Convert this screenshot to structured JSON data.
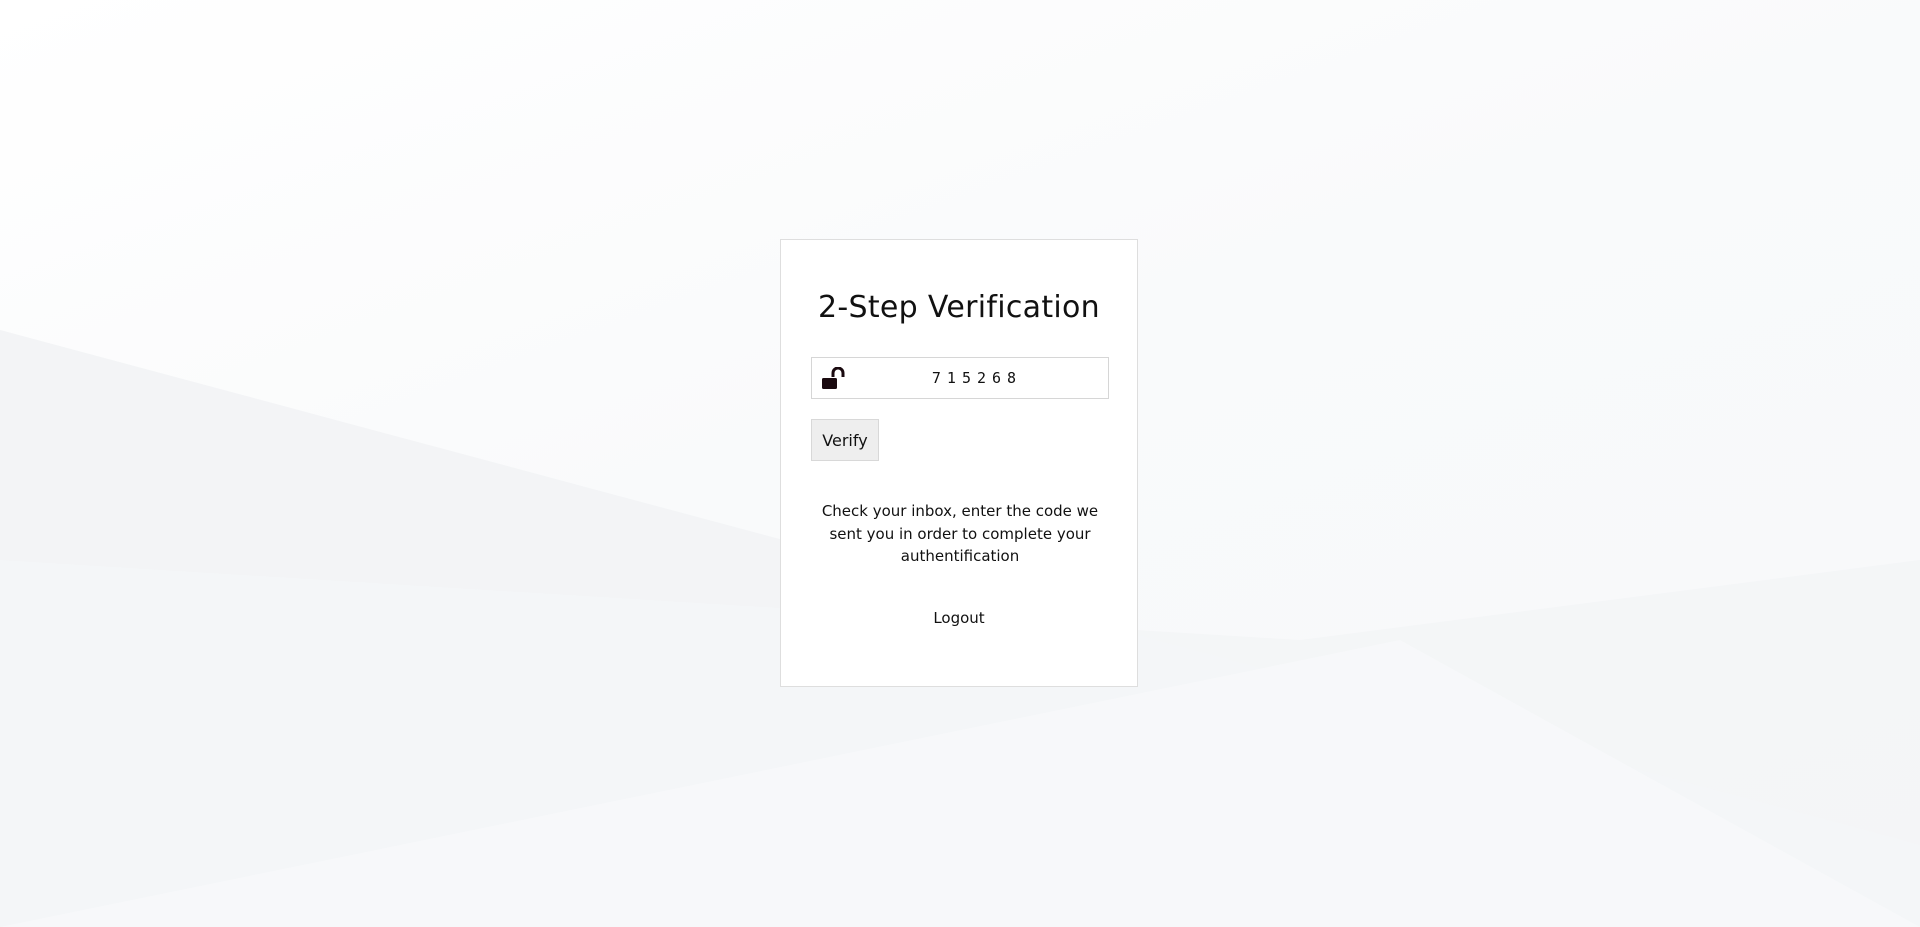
{
  "card": {
    "title": "2-Step Verification",
    "code": {
      "value": "715268",
      "icon": "unlock-icon"
    },
    "verify_label": "Verify",
    "hint": "Check your inbox, enter the code we sent you in order to complete your authentification",
    "logout_label": "Logout"
  },
  "colors": {
    "lock_icon": "#1a0a0f",
    "background": "#f7f8fa",
    "card_border": "#dedede",
    "button_bg": "#eeeeee"
  }
}
